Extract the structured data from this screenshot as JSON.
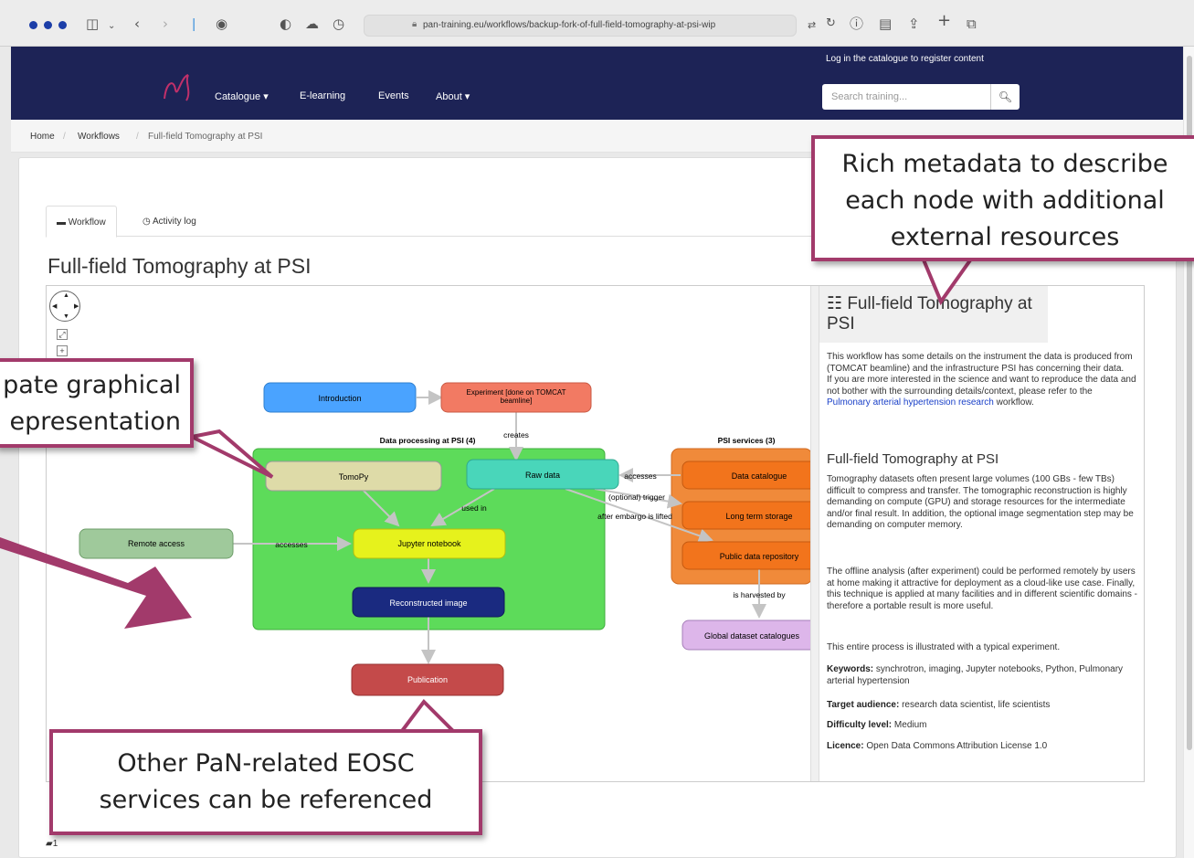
{
  "browser": {
    "url": "pan-training.eu/workflows/backup-fork-of-full-field-tomography-at-psi-wip",
    "traffic_light_color": "#1c3ea8"
  },
  "site": {
    "nav_bg": "#1d2356",
    "nav": [
      {
        "label": "Catalogue ▾"
      },
      {
        "label": "E-learning"
      },
      {
        "label": "Events"
      },
      {
        "label": "About ▾"
      }
    ],
    "login_text": "Log in the catalogue to register content",
    "search_placeholder": "Search training..."
  },
  "breadcrumb": {
    "home": "Home",
    "workflows": "Workflows",
    "current": "Full-field Tomography at PSI"
  },
  "tabs": [
    {
      "label": "Workflow"
    },
    {
      "label": "Activity log"
    }
  ],
  "page_title": "Full-field Tomography at PSI",
  "graph": {
    "nodes": {
      "introduction": "Introduction",
      "experiment": "Experiment [done on TOMCAT beamline]",
      "tomopy": "TomoPy",
      "raw_data": "Raw data",
      "jupyter": "Jupyter notebook",
      "reconstructed": "Reconstructed image",
      "remote_access": "Remote access",
      "publication": "Publication",
      "data_catalogue": "Data catalogue",
      "long_term_storage": "Long term storage",
      "public_repo": "Public data repository",
      "global_catalogues": "Global dataset catalogues"
    },
    "groups": {
      "psi_processing": "Data processing at PSI (4)",
      "psi_services": "PSI services (3)"
    },
    "edges": {
      "creates": "creates",
      "used_in": "used in",
      "accesses_remote": "accesses",
      "accesses_catalogue": "accesses",
      "optional_trigger": "(optional) trigger",
      "after_embargo": "after embargo is lifted",
      "harvested": "is harvested by"
    }
  },
  "info_panel": {
    "title": "Full-field Tomography at PSI",
    "intro_1": "This workflow has some details on the instrument the data is produced from (TOMCAT beamline) and the infrastructure PSI has concerning their data.",
    "intro_2": "If you are more interested in the science and want to reproduce the data and not bother with the surrounding details/context, please refer to the",
    "link": "Pulmonary arterial hypertension research",
    "intro_3": "workflow.",
    "subtitle": "Full-field Tomography at PSI",
    "para_1": "Tomography datasets often present large volumes (100 GBs - few TBs) difficult to compress and transfer. The tomographic reconstruction is highly demanding on compute (GPU) and storage resources for the intermediate and/or final result. In addition, the optional image segmentation step may be demanding on computer memory.",
    "para_2": "The offline analysis (after experiment) could be performed remotely by users at home making it attractive for deployment as a cloud-like use case. Finally, this technique is applied at many facilities and in different scientific domains - therefore a portable result is more useful.",
    "para_3": "This entire process is illustrated with a typical experiment.",
    "keywords_label": "Keywords:",
    "keywords": "synchrotron, imaging, Jupyter notebooks, Python, Pulmonary arterial hypertension",
    "audience_label": "Target audience:",
    "audience": "research data scientist, life scientists",
    "difficulty_label": "Difficulty level:",
    "difficulty": "Medium",
    "licence_label": "Licence:",
    "licence": "Open Data Commons Attribution License 1.0"
  },
  "bottom_count": "1",
  "callouts": {
    "metadata": "Rich metadata to describe each node with additional external resources",
    "graphical_line1": "pate graphical",
    "graphical_line2": "epresentation",
    "services": "Other PaN-related EOSC services can be referenced",
    "color": "#a23a6b"
  }
}
